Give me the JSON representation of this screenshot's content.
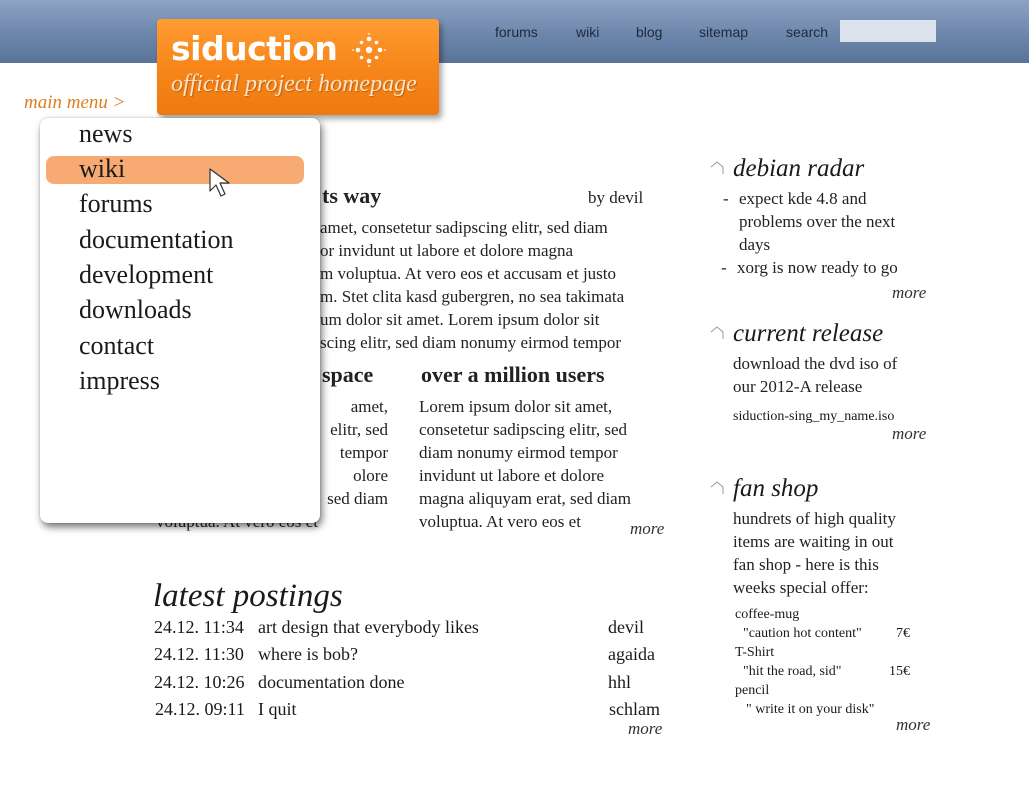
{
  "header": {
    "nav": [
      "forums",
      "wiki",
      "blog",
      "sitemap",
      "search"
    ],
    "search_value": ""
  },
  "logo": {
    "name": "siduction",
    "tagline": "official project homepage"
  },
  "menu": {
    "label": "main menu >",
    "items": [
      "news",
      "wiki",
      "forums",
      "documentation",
      "development",
      "downloads",
      "contact",
      "impress"
    ],
    "highlighted": "wiki"
  },
  "article": {
    "title_fragment": "ts way",
    "byline": "by devil",
    "lines": [
      "amet, consetetur sadipscing elitr, sed diam",
      "or invidunt ut labore et dolore magna",
      "m voluptua. At vero eos et accusam et justo",
      "m. Stet clita kasd gubergren, no sea takimata",
      "um dolor sit amet. Lorem ipsum dolor sit",
      "scing elitr, sed diam nonumy eirmod tempor"
    ]
  },
  "col_left": {
    "title_fragment": "space",
    "lines": [
      "amet,",
      "elitr, sed",
      "tempor",
      "olore",
      "sed diam",
      "voluptua. At vero eos et"
    ]
  },
  "col_right": {
    "title": "over a million users",
    "lines": [
      "Lorem ipsum dolor sit amet,",
      "consetetur sadipscing elitr, sed",
      "diam nonumy eirmod tempor",
      "invidunt ut labore et dolore",
      "magna aliquyam erat, sed diam",
      "voluptua. At vero eos et"
    ],
    "more": "more"
  },
  "postings": {
    "title": "latest postings",
    "rows": [
      {
        "time": "24.12. 11:34",
        "subject": "art design that everybody likes",
        "author": "devil"
      },
      {
        "time": "24.12. 11:30",
        "subject": "where is bob?",
        "author": "agaida"
      },
      {
        "time": "24.12. 10:26",
        "subject": "documentation done",
        "author": "hhl"
      },
      {
        "time": "24.12. 09:11",
        "subject": "I quit",
        "author": "schlam"
      }
    ],
    "more": "more"
  },
  "sidebar": {
    "debian_radar": {
      "title": "debian radar",
      "items": [
        {
          "dash": "-",
          "lines": [
            "expect kde 4.8 and",
            "problems over the next",
            "days"
          ]
        },
        {
          "dash": "-",
          "lines": [
            "xorg is now ready to go"
          ]
        }
      ],
      "more": "more"
    },
    "current_release": {
      "title": "current release",
      "lines": [
        "download the dvd iso of",
        "our 2012-A release"
      ],
      "file": "siduction-sing_my_name.iso",
      "more": "more"
    },
    "fan_shop": {
      "title": "fan shop",
      "lines": [
        "hundrets of high quality",
        "items are waiting in out",
        "fan shop - here is this",
        "weeks special offer:"
      ],
      "offers": [
        {
          "name": "coffee-mug",
          "desc": "\"caution hot content\"",
          "price": "7€"
        },
        {
          "name": "T-Shirt",
          "desc": "\"hit the road, sid\"",
          "price": "15€"
        },
        {
          "name": "pencil",
          "desc": "\" write it on your disk\"",
          "price": ""
        }
      ],
      "more": "more"
    }
  },
  "colors": {
    "header_blue": "#6d86ab",
    "logo_orange": "#f7861a",
    "menu_label_orange": "#e07d1c",
    "menu_highlight": "#f7ab73"
  }
}
